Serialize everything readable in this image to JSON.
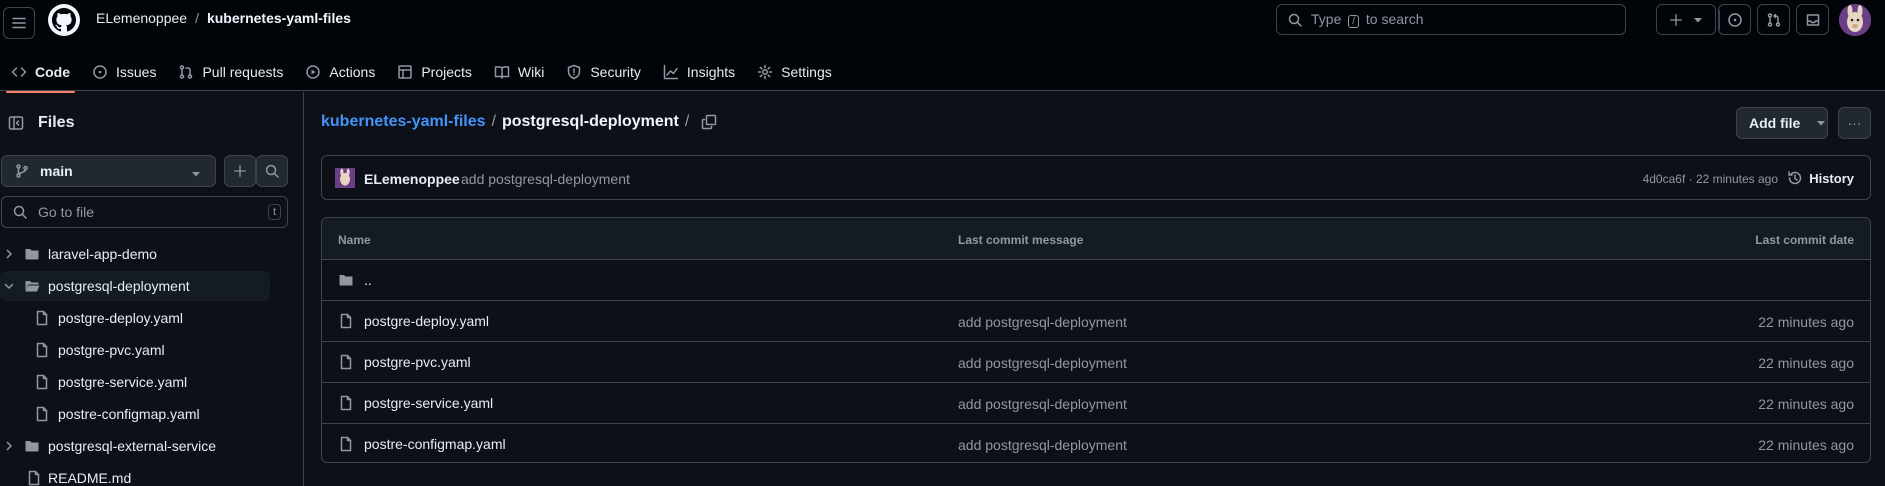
{
  "header": {
    "owner": "ELemenoppee",
    "separator": "/",
    "repo": "kubernetes-yaml-files",
    "search_prefix": "Type",
    "search_key": "/",
    "search_suffix": "to search"
  },
  "nav": [
    {
      "label": "Code",
      "icon": "code-icon",
      "active": true
    },
    {
      "label": "Issues",
      "icon": "issue-icon"
    },
    {
      "label": "Pull requests",
      "icon": "pull-request-icon"
    },
    {
      "label": "Actions",
      "icon": "play-icon"
    },
    {
      "label": "Projects",
      "icon": "table-icon"
    },
    {
      "label": "Wiki",
      "icon": "book-icon"
    },
    {
      "label": "Security",
      "icon": "shield-icon"
    },
    {
      "label": "Insights",
      "icon": "graph-icon"
    },
    {
      "label": "Settings",
      "icon": "gear-icon"
    }
  ],
  "sidebar": {
    "title": "Files",
    "branch": "main",
    "goto_placeholder": "Go to file",
    "goto_key": "t",
    "tree": [
      {
        "label": "laravel-app-demo",
        "type": "folder",
        "expanded": false
      },
      {
        "label": "postgresql-deployment",
        "type": "folder",
        "expanded": true,
        "selected": true
      },
      {
        "label": "postgre-deploy.yaml",
        "type": "file"
      },
      {
        "label": "postgre-pvc.yaml",
        "type": "file"
      },
      {
        "label": "postgre-service.yaml",
        "type": "file"
      },
      {
        "label": "postre-configmap.yaml",
        "type": "file"
      },
      {
        "label": "postgresql-external-service",
        "type": "folder",
        "expanded": false
      },
      {
        "label": "README.md",
        "type": "file"
      }
    ]
  },
  "main": {
    "path_repo": "kubernetes-yaml-files",
    "path_sep1": "/",
    "path_dir": "postgresql-deployment",
    "path_sep2": "/",
    "add_file_label": "Add file",
    "more_label": "···",
    "commit": {
      "author": "ELemenoppee",
      "message": "add postgresql-deployment",
      "meta": "4d0ca6f · 22 minutes ago",
      "history_label": "History"
    },
    "table": {
      "headers": [
        "Name",
        "Last commit message",
        "Last commit date"
      ],
      "parent_label": "..",
      "rows": [
        {
          "name": "postgre-deploy.yaml",
          "message": "add postgresql-deployment",
          "date": "22 minutes ago"
        },
        {
          "name": "postgre-pvc.yaml",
          "message": "add postgresql-deployment",
          "date": "22 minutes ago"
        },
        {
          "name": "postgre-service.yaml",
          "message": "add postgresql-deployment",
          "date": "22 minutes ago"
        },
        {
          "name": "postre-configmap.yaml",
          "message": "add postgresql-deployment",
          "date": "22 minutes ago"
        }
      ]
    }
  },
  "colors": {
    "accent_underline": "#f78166",
    "link": "#4493f8",
    "background": "#0d1117",
    "header_bg": "#010409",
    "border": "#3d444d",
    "muted": "#9198a1"
  }
}
